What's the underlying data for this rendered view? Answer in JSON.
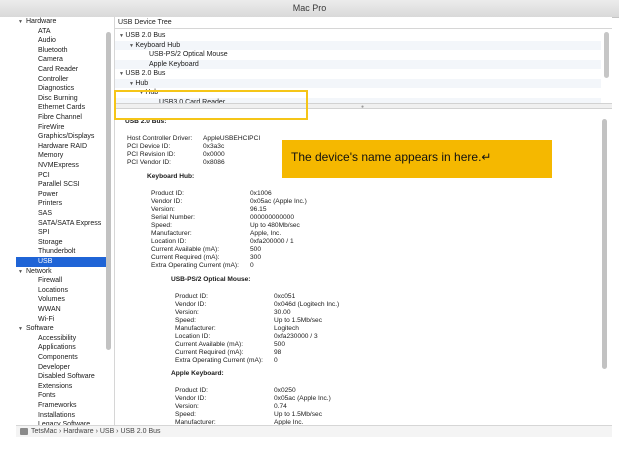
{
  "window": {
    "title": "Mac Pro"
  },
  "sidebar": {
    "rows": [
      {
        "label": "Hardware",
        "kind": "cat",
        "selected": false
      },
      {
        "label": "ATA",
        "kind": "item",
        "selected": false
      },
      {
        "label": "Audio",
        "kind": "item",
        "selected": false
      },
      {
        "label": "Bluetooth",
        "kind": "item",
        "selected": false
      },
      {
        "label": "Camera",
        "kind": "item",
        "selected": false
      },
      {
        "label": "Card Reader",
        "kind": "item",
        "selected": false
      },
      {
        "label": "Controller",
        "kind": "item",
        "selected": false
      },
      {
        "label": "Diagnostics",
        "kind": "item",
        "selected": false
      },
      {
        "label": "Disc Burning",
        "kind": "item",
        "selected": false
      },
      {
        "label": "Ethernet Cards",
        "kind": "item",
        "selected": false
      },
      {
        "label": "Fibre Channel",
        "kind": "item",
        "selected": false
      },
      {
        "label": "FireWire",
        "kind": "item",
        "selected": false
      },
      {
        "label": "Graphics/Displays",
        "kind": "item",
        "selected": false
      },
      {
        "label": "Hardware RAID",
        "kind": "item",
        "selected": false
      },
      {
        "label": "Memory",
        "kind": "item",
        "selected": false
      },
      {
        "label": "NVMExpress",
        "kind": "item",
        "selected": false
      },
      {
        "label": "PCI",
        "kind": "item",
        "selected": false
      },
      {
        "label": "Parallel SCSI",
        "kind": "item",
        "selected": false
      },
      {
        "label": "Power",
        "kind": "item",
        "selected": false
      },
      {
        "label": "Printers",
        "kind": "item",
        "selected": false
      },
      {
        "label": "SAS",
        "kind": "item",
        "selected": false
      },
      {
        "label": "SATA/SATA Express",
        "kind": "item",
        "selected": false
      },
      {
        "label": "SPI",
        "kind": "item",
        "selected": false
      },
      {
        "label": "Storage",
        "kind": "item",
        "selected": false
      },
      {
        "label": "Thunderbolt",
        "kind": "item",
        "selected": false
      },
      {
        "label": "USB",
        "kind": "item",
        "selected": true
      },
      {
        "label": "Network",
        "kind": "cat",
        "selected": false
      },
      {
        "label": "Firewall",
        "kind": "item",
        "selected": false
      },
      {
        "label": "Locations",
        "kind": "item",
        "selected": false
      },
      {
        "label": "Volumes",
        "kind": "item",
        "selected": false
      },
      {
        "label": "WWAN",
        "kind": "item",
        "selected": false
      },
      {
        "label": "Wi-Fi",
        "kind": "item",
        "selected": false
      },
      {
        "label": "Software",
        "kind": "cat",
        "selected": false
      },
      {
        "label": "Accessibility",
        "kind": "item",
        "selected": false
      },
      {
        "label": "Applications",
        "kind": "item",
        "selected": false
      },
      {
        "label": "Components",
        "kind": "item",
        "selected": false
      },
      {
        "label": "Developer",
        "kind": "item",
        "selected": false
      },
      {
        "label": "Disabled Software",
        "kind": "item",
        "selected": false
      },
      {
        "label": "Extensions",
        "kind": "item",
        "selected": false
      },
      {
        "label": "Fonts",
        "kind": "item",
        "selected": false
      },
      {
        "label": "Frameworks",
        "kind": "item",
        "selected": false
      },
      {
        "label": "Installations",
        "kind": "item",
        "selected": false
      },
      {
        "label": "Legacy Software",
        "kind": "item",
        "selected": false
      }
    ]
  },
  "tree": {
    "header": "USB Device Tree",
    "rows": [
      {
        "label": "USB 2.0 Bus",
        "depth": 0,
        "tri": true
      },
      {
        "label": "Keyboard Hub",
        "depth": 1,
        "tri": true
      },
      {
        "label": "USB-PS/2 Optical Mouse",
        "depth": 2,
        "tri": false
      },
      {
        "label": "Apple Keyboard",
        "depth": 2,
        "tri": false
      },
      {
        "label": "USB 2.0 Bus",
        "depth": 0,
        "tri": true
      },
      {
        "label": "Hub",
        "depth": 1,
        "tri": true
      },
      {
        "label": "Hub",
        "depth": 2,
        "tri": true
      },
      {
        "label": "USB3.0 Card Reader",
        "depth": 3,
        "tri": false
      }
    ]
  },
  "details": {
    "bus_title": "USB 2.0 Bus:",
    "bus_props": [
      {
        "k": "Host Controller Driver:",
        "v": "AppleUSBEHCIPCI"
      },
      {
        "k": "PCI Device ID:",
        "v": "0x3a3c"
      },
      {
        "k": "PCI Revision ID:",
        "v": "0x0000"
      },
      {
        "k": "PCI Vendor ID:",
        "v": "0x8086"
      }
    ],
    "devices": [
      {
        "title": "Keyboard Hub:",
        "props": [
          {
            "k": "Product ID:",
            "v": "0x1006"
          },
          {
            "k": "Vendor ID:",
            "v": "0x05ac (Apple Inc.)"
          },
          {
            "k": "Version:",
            "v": "96.15"
          },
          {
            "k": "Serial Number:",
            "v": "000000000000"
          },
          {
            "k": "Speed:",
            "v": "Up to 480Mb/sec"
          },
          {
            "k": "Manufacturer:",
            "v": "Apple, Inc."
          },
          {
            "k": "Location ID:",
            "v": "0xfa200000 / 1"
          },
          {
            "k": "Current Available (mA):",
            "v": "500"
          },
          {
            "k": "Current Required (mA):",
            "v": "300"
          },
          {
            "k": "Extra Operating Current (mA):",
            "v": "0"
          }
        ]
      },
      {
        "title": "USB-PS/2 Optical Mouse:",
        "props": [
          {
            "k": "Product ID:",
            "v": "0xc051"
          },
          {
            "k": "Vendor ID:",
            "v": "0x046d  (Logitech Inc.)"
          },
          {
            "k": "Version:",
            "v": "30.00"
          },
          {
            "k": "Speed:",
            "v": "Up to 1.5Mb/sec"
          },
          {
            "k": "Manufacturer:",
            "v": "Logitech"
          },
          {
            "k": "Location ID:",
            "v": "0xfa230000 / 3"
          },
          {
            "k": "Current Available (mA):",
            "v": "500"
          },
          {
            "k": "Current Required (mA):",
            "v": "98"
          },
          {
            "k": "Extra Operating Current (mA):",
            "v": "0"
          }
        ]
      },
      {
        "title": "Apple Keyboard:",
        "props": [
          {
            "k": "Product ID:",
            "v": "0x0250"
          },
          {
            "k": "Vendor ID:",
            "v": "0x05ac (Apple Inc.)"
          },
          {
            "k": "Version:",
            "v": "0.74"
          },
          {
            "k": "Speed:",
            "v": "Up to 1.5Mb/sec"
          },
          {
            "k": "Manufacturer:",
            "v": "Apple Inc."
          }
        ]
      }
    ]
  },
  "callout": {
    "text": "The device's name appears in here.↵"
  },
  "statusbar": {
    "path": "TetsMac › Hardware › USB › USB 2.0 Bus"
  },
  "colors": {
    "selection": "#1f64d6",
    "callout": "#f5b800",
    "highlight": "#f5c518"
  }
}
